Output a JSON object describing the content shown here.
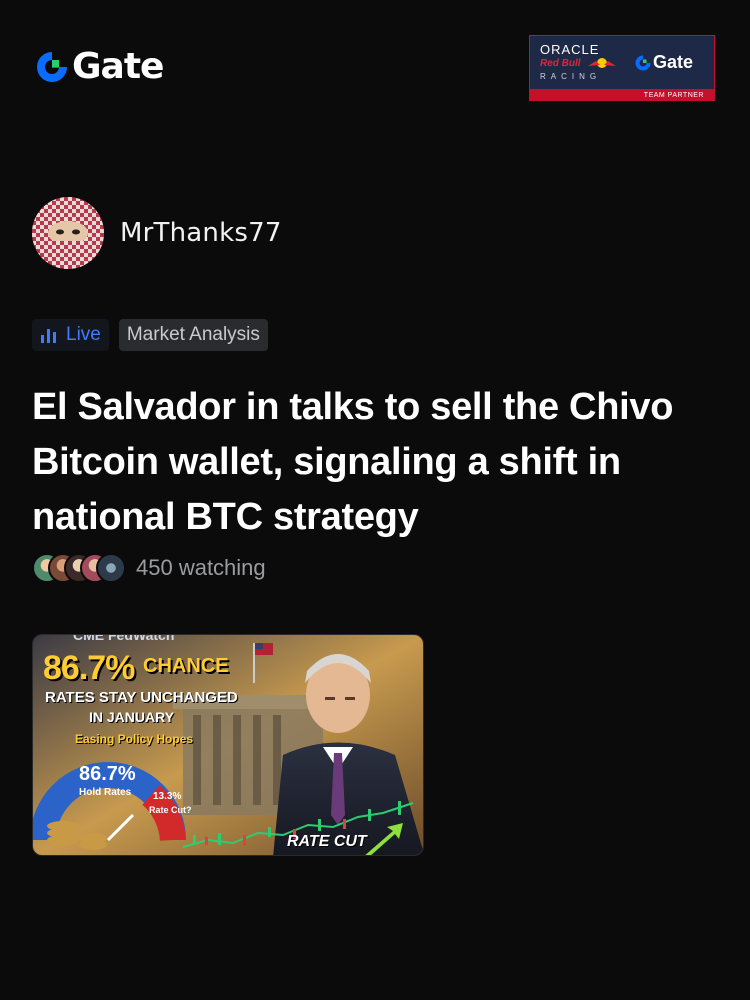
{
  "header": {
    "logo_text": "Gate",
    "partner": {
      "oracle": "ORACLE",
      "redbull": "Red Bull",
      "racing": "RACING",
      "gate": "Gate",
      "team": "TEAM PARTNER"
    }
  },
  "author": {
    "name": "MrThanks77"
  },
  "tags": {
    "live": "Live",
    "category": "Market Analysis"
  },
  "post": {
    "title": "El Salvador in talks to sell the Chivo Bitcoin wallet, signaling a shift in national BTC strategy",
    "watching": "450 watching"
  },
  "thumbnail": {
    "header": "CME FedWatch",
    "big_percent": "86.7%",
    "chance": "CHANCE",
    "line1": "RATES STAY UNCHANGED",
    "line2": "IN JANUARY",
    "line3": "Easing Policy Hopes",
    "gauge_value": "86.7%",
    "gauge_label": "Hold Rates",
    "cut_value": "13.3%",
    "cut_label": "Rate Cut?",
    "rate_cut": "RATE CUT"
  },
  "colors": {
    "background": "#0b0b0c",
    "gate_blue": "#0a6cff",
    "gate_green": "#2ecc71",
    "live_blue": "#3d7bff",
    "muted_text": "#9b9ca0"
  },
  "icons": {
    "live": "bar-chart-icon",
    "logo": "gate-logo-icon"
  }
}
